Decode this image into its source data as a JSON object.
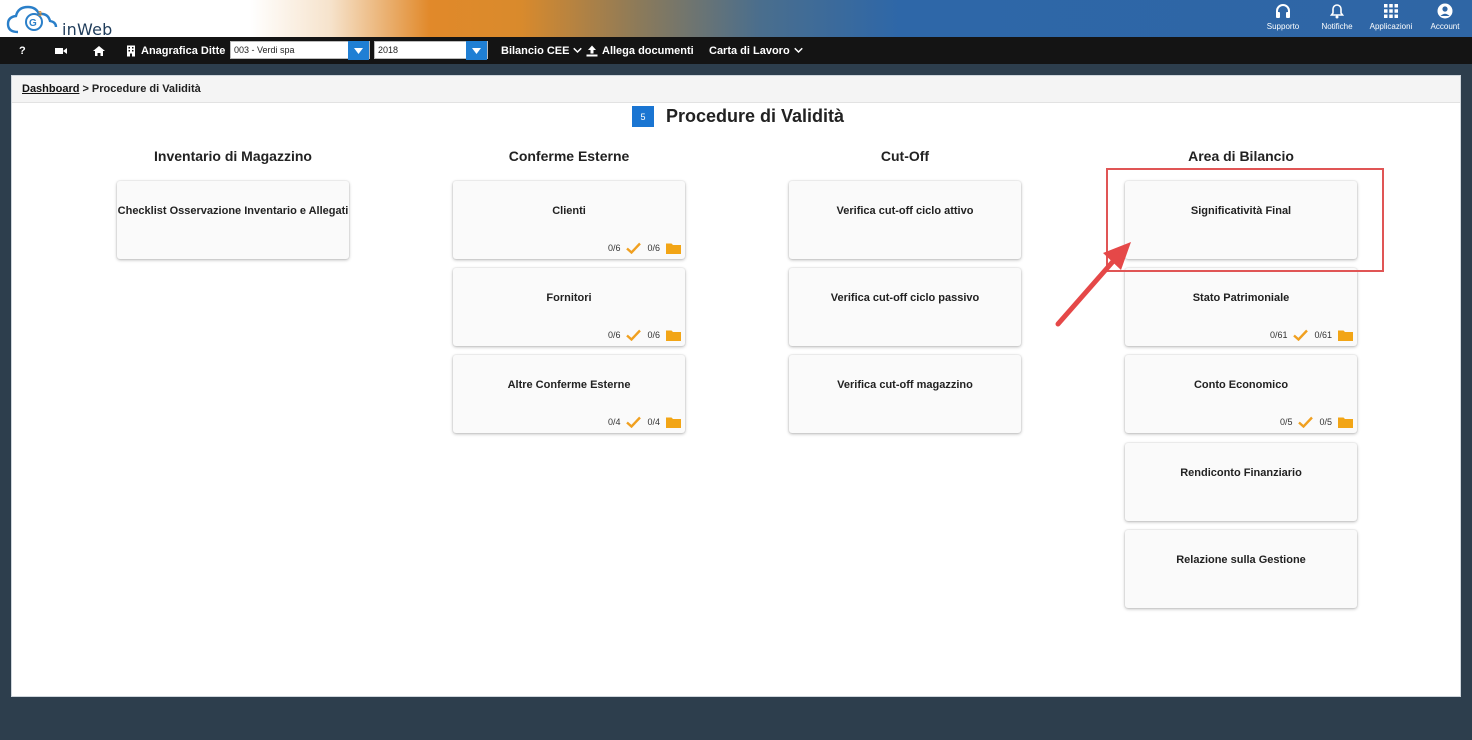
{
  "header": {
    "logo_text": "inWeb",
    "buttons": [
      {
        "label": "Supporto",
        "icon": "headset-icon"
      },
      {
        "label": "Notifiche",
        "icon": "bell-icon"
      },
      {
        "label": "Applicazioni",
        "icon": "grid-icon"
      },
      {
        "label": "Account",
        "icon": "user-circle-icon"
      }
    ]
  },
  "navbar": {
    "help": "?",
    "anagrafica_label": "Anagrafica Ditte",
    "company_select_value": "003 - Verdi spa",
    "year_select_value": "2018",
    "bilancio_label": "Bilancio CEE",
    "allega_label": "Allega documenti",
    "carta_label": "Carta di Lavoro"
  },
  "breadcrumb": {
    "root": "Dashboard",
    "separator": ">",
    "current": "Procedure di Validità"
  },
  "page": {
    "badge": "5",
    "title": "Procedure di Validità"
  },
  "columns": [
    {
      "title": "Inventario di Magazzino",
      "cards": [
        {
          "label": "Checklist Osservazione Inventario e Allegati",
          "done": "",
          "files": ""
        }
      ]
    },
    {
      "title": "Conferme Esterne",
      "cards": [
        {
          "label": "Clienti",
          "done": "0/6",
          "files": "0/6"
        },
        {
          "label": "Fornitori",
          "done": "0/6",
          "files": "0/6"
        },
        {
          "label": "Altre Conferme Esterne",
          "done": "0/4",
          "files": "0/4"
        }
      ]
    },
    {
      "title": "Cut-Off",
      "cards": [
        {
          "label": "Verifica cut-off ciclo attivo",
          "done": "",
          "files": ""
        },
        {
          "label": "Verifica cut-off ciclo passivo",
          "done": "",
          "files": ""
        },
        {
          "label": "Verifica cut-off magazzino",
          "done": "",
          "files": ""
        }
      ]
    },
    {
      "title": "Area di Bilancio",
      "cards": [
        {
          "label": "Significatività Final",
          "done": "",
          "files": ""
        },
        {
          "label": "Stato Patrimoniale",
          "done": "0/61",
          "files": "0/61"
        },
        {
          "label": "Conto Economico",
          "done": "0/5",
          "files": "0/5"
        },
        {
          "label": "Rendiconto Finanziario",
          "done": "",
          "files": ""
        },
        {
          "label": "Relazione sulla Gestione",
          "done": "",
          "files": ""
        }
      ]
    }
  ],
  "colors": {
    "accent": "#1a75d2",
    "check": "#f0a020",
    "folder": "#f2a516",
    "highlight": "#e05555"
  }
}
